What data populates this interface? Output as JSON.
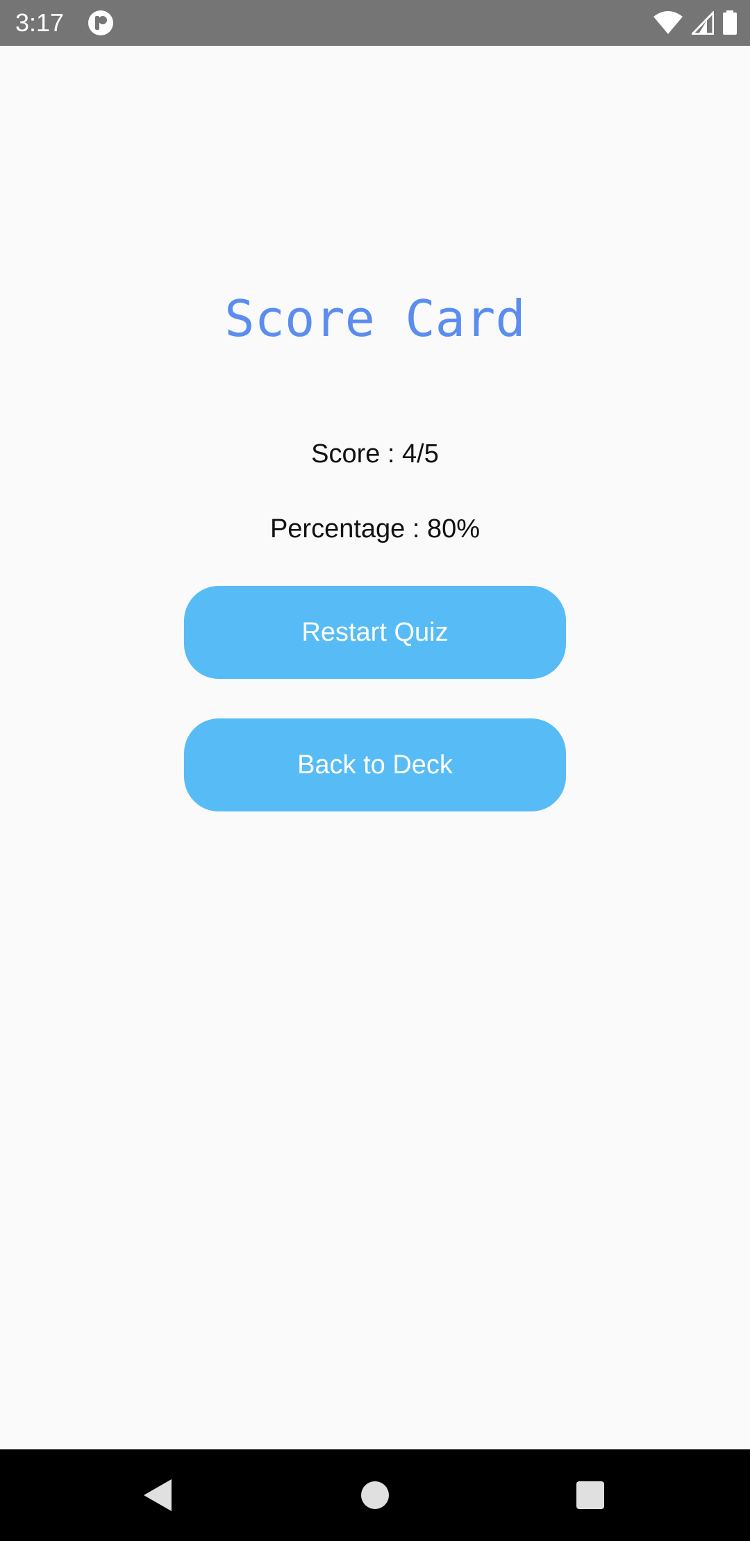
{
  "status_bar": {
    "time": "3:17",
    "app_icon": "notification-app-icon",
    "icons": [
      "wifi-icon",
      "cell-signal-icon",
      "battery-icon"
    ]
  },
  "screen": {
    "title": "Score Card",
    "score_text": "Score : 4/5",
    "percentage_text": "Percentage : 80%",
    "restart_button_label": "Restart Quiz",
    "back_button_label": "Back to Deck"
  },
  "nav_bar": {
    "icons": [
      "back-triangle-icon",
      "home-circle-icon",
      "recents-square-icon"
    ]
  },
  "colors": {
    "status_bar_bg": "#757575",
    "background": "#fafafa",
    "title": "#5b8def",
    "button_bg": "#57bcf6",
    "button_text": "#ffffff",
    "nav_bar_bg": "#000000"
  }
}
